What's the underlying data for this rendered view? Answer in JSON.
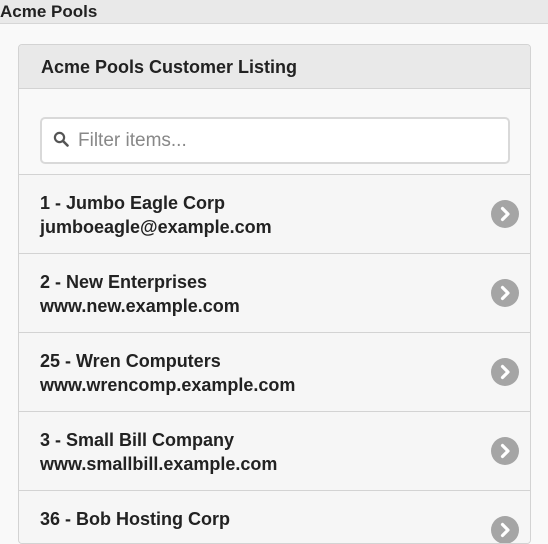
{
  "app": {
    "title": "Acme Pools"
  },
  "panel": {
    "title": "Acme Pools Customer Listing"
  },
  "search": {
    "placeholder": "Filter items..."
  },
  "customers": [
    {
      "title": "1 - Jumbo Eagle Corp",
      "subtitle": "jumboeagle@example.com"
    },
    {
      "title": "2 - New Enterprises",
      "subtitle": "www.new.example.com"
    },
    {
      "title": "25 - Wren Computers",
      "subtitle": "www.wrencomp.example.com"
    },
    {
      "title": "3 - Small Bill Company",
      "subtitle": "www.smallbill.example.com"
    },
    {
      "title": "36 - Bob Hosting Corp",
      "subtitle": ""
    }
  ],
  "icons": {
    "search": "search-icon",
    "chevron": "chevron-right-circle-icon"
  },
  "colors": {
    "header_bg": "#e9e9e9",
    "chevron_bg": "#a5a5a5"
  }
}
